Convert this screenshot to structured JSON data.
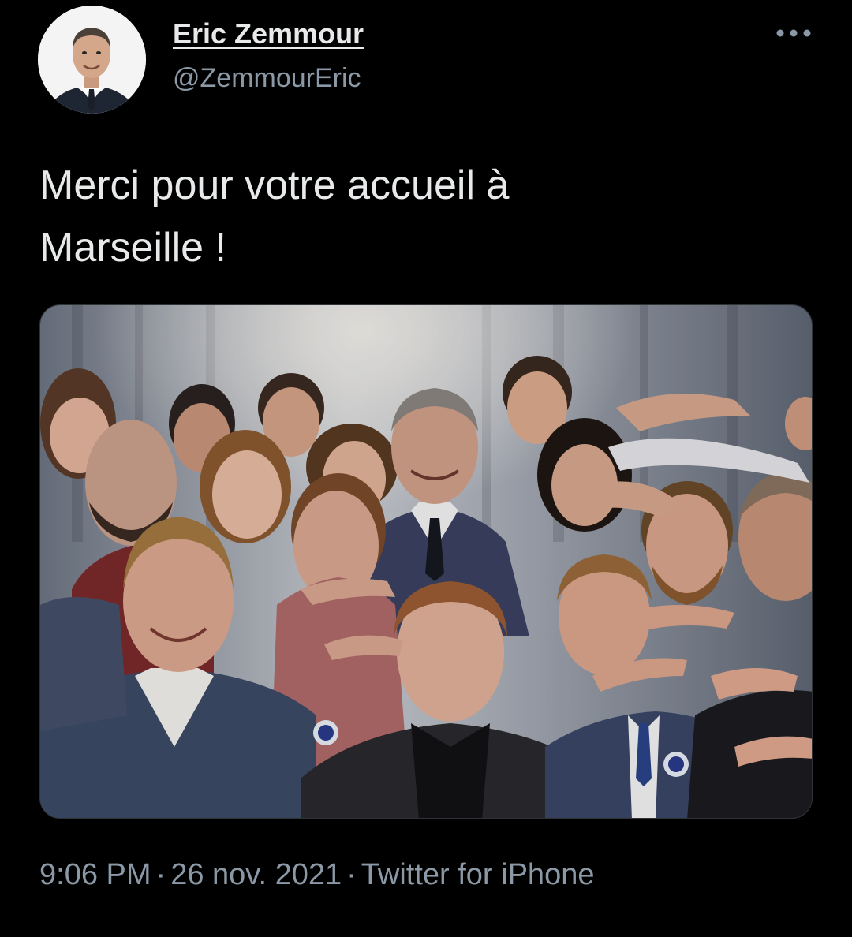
{
  "user": {
    "display_name": "Eric Zemmour",
    "handle": "@ZemmourEric",
    "avatar_icon": "profile-photo"
  },
  "header": {
    "more_icon": "more-horizontal-icon"
  },
  "tweet": {
    "text_line1": "Merci pour votre accueil à",
    "text_line2": "Marseille !",
    "media_description": "group-photo"
  },
  "meta": {
    "time": "9:06 PM",
    "separator": "·",
    "date": "26 nov. 2021",
    "source": "Twitter for iPhone"
  },
  "colors": {
    "background": "#000000",
    "primary_text": "#e7e9ea",
    "secondary_text": "#8b98a5"
  }
}
